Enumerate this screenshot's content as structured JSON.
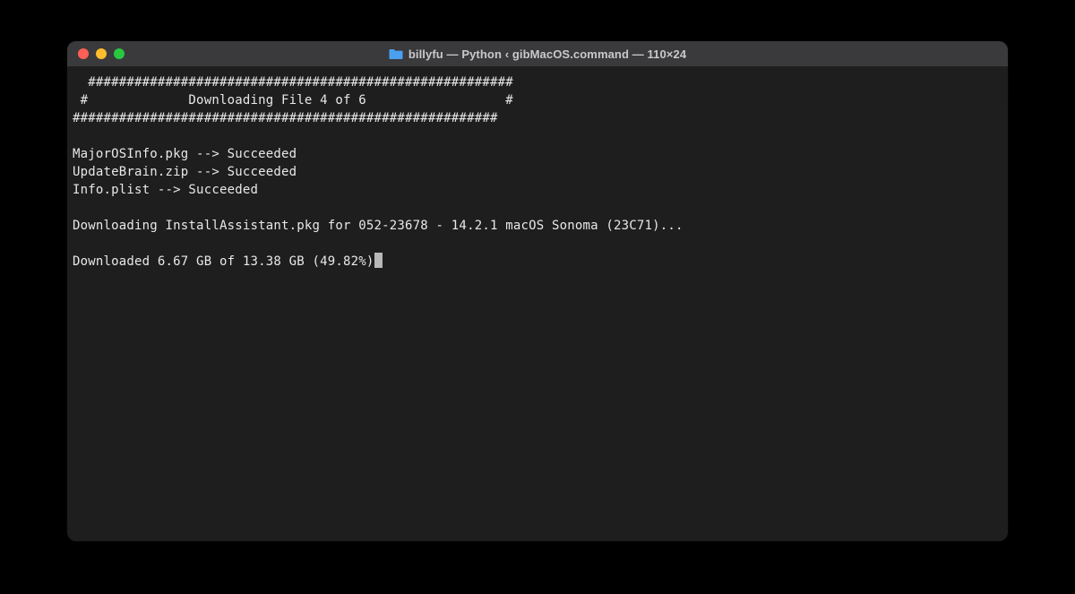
{
  "titlebar": {
    "title": "billyfu — Python ‹ gibMacOS.command — 110×24",
    "traffic_lights": {
      "close_color": "#ff5f57",
      "minimize_color": "#febc2e",
      "maximize_color": "#28c840"
    }
  },
  "terminal": {
    "header_border1": "  #######################################################",
    "header_text": " #             Downloading File 4 of 6                  #",
    "header_border2": "#######################################################",
    "blank1": "",
    "line_file1": "MajorOSInfo.pkg --> Succeeded",
    "line_file2": "UpdateBrain.zip --> Succeeded",
    "line_file3": "Info.plist --> Succeeded",
    "blank2": "",
    "downloading_line": "Downloading InstallAssistant.pkg for 052-23678 - 14.2.1 macOS Sonoma (23C71)...",
    "blank3": "",
    "progress_line": "Downloaded 6.67 GB of 13.38 GB (49.82%)"
  }
}
